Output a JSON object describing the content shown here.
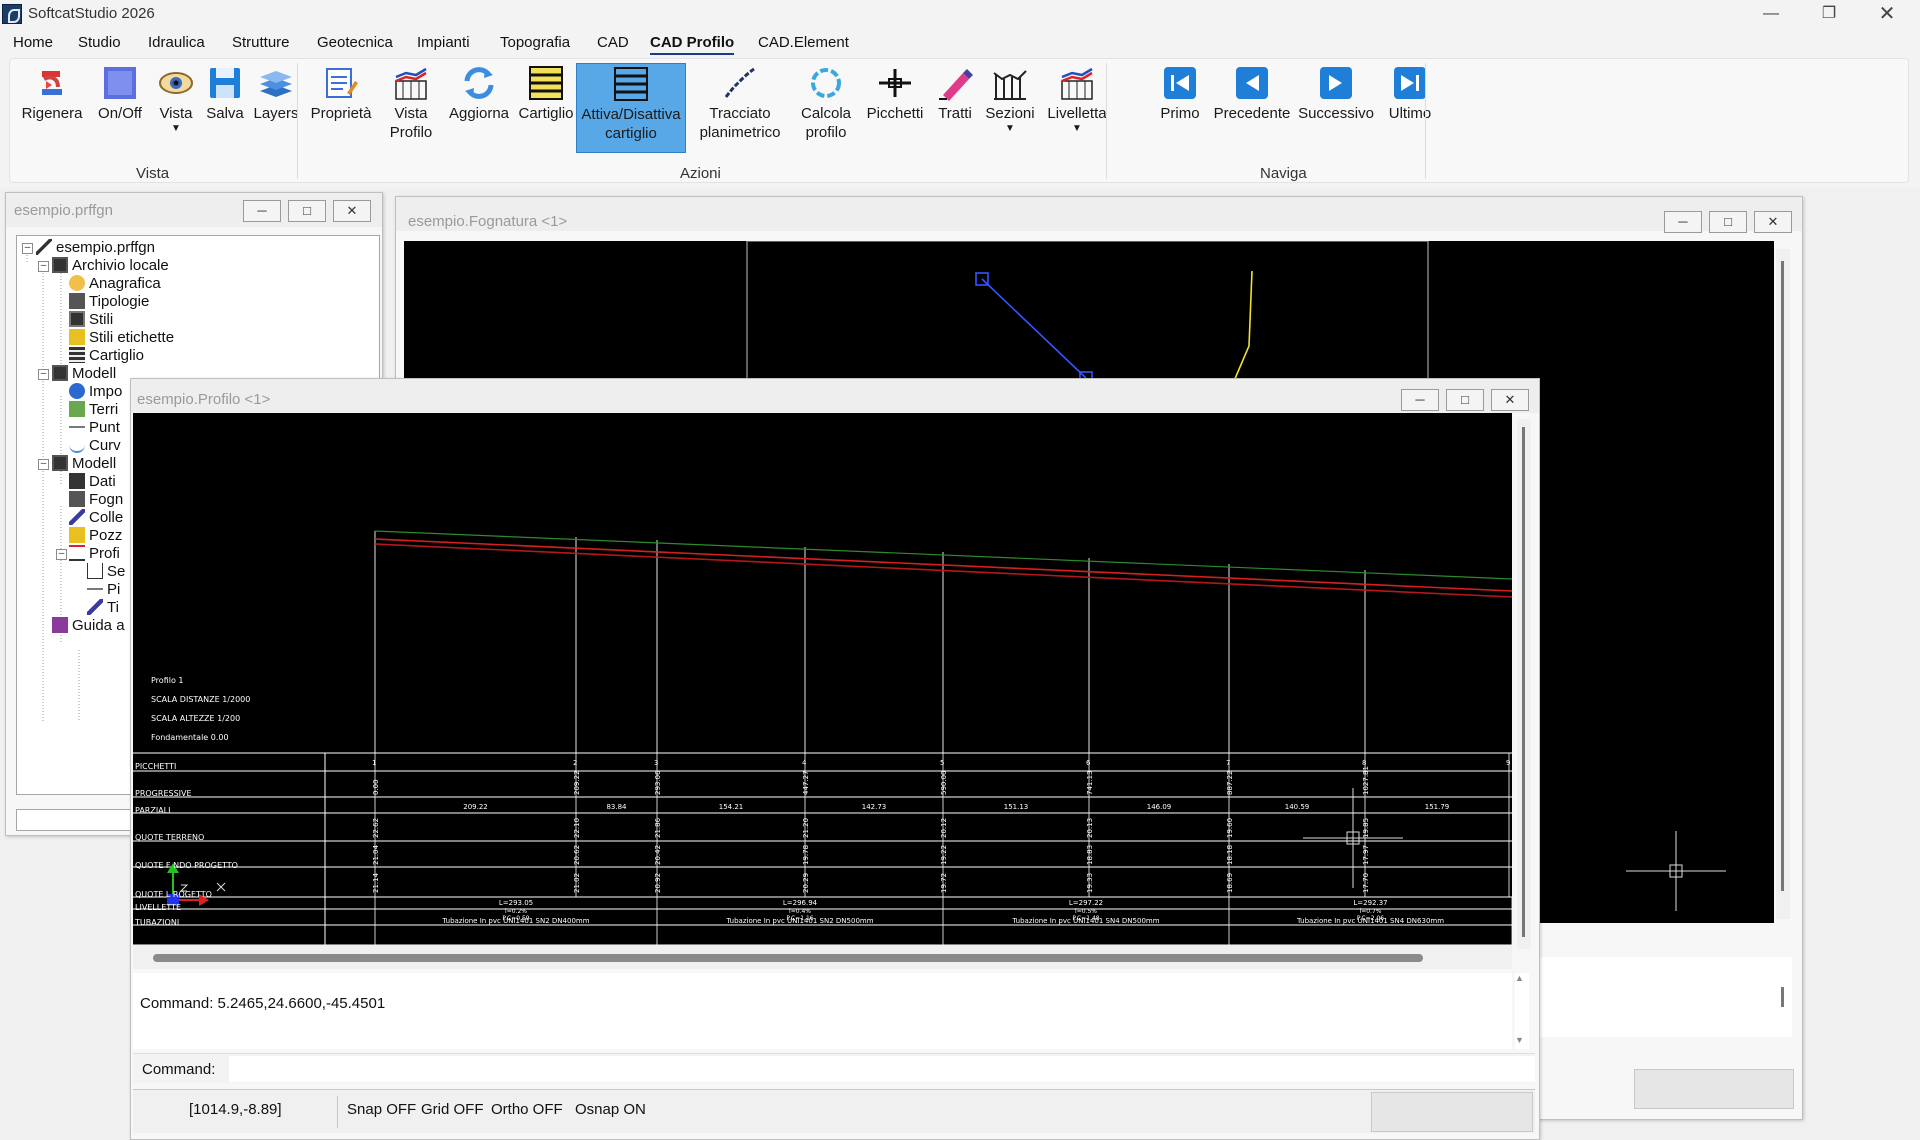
{
  "app": {
    "title": "SoftcatStudio 2026"
  },
  "menu": [
    {
      "label": "Home"
    },
    {
      "label": "Studio"
    },
    {
      "label": "Idraulica"
    },
    {
      "label": "Strutture"
    },
    {
      "label": "Geotecnica"
    },
    {
      "label": "Impianti"
    },
    {
      "label": "Topografia"
    },
    {
      "label": "CAD"
    },
    {
      "label": "CAD Profilo"
    },
    {
      "label": "CAD.Element"
    }
  ],
  "active_menu": "CAD Profilo",
  "ribbon": {
    "groups": {
      "vista": "Vista",
      "azioni": "Azioni",
      "naviga": "Naviga"
    },
    "vista": {
      "rigenera": "Rigenera",
      "onoff": "On/Off",
      "vista": "Vista",
      "salva": "Salva",
      "layers": "Layers"
    },
    "azioni": {
      "proprieta": "Proprietà",
      "vista_profilo_1": "Vista",
      "vista_profilo_2": "Profilo",
      "aggiorna": "Aggiorna",
      "cartiglio": "Cartiglio",
      "attiva_1": "Attiva/Disattiva",
      "attiva_2": "cartiglio",
      "tracciato_1": "Tracciato",
      "tracciato_2": "planimetrico",
      "calcola_1": "Calcola",
      "calcola_2": "profilo",
      "picchetti": "Picchetti",
      "tratti": "Tratti",
      "sezioni": "Sezioni",
      "livelletta": "Livelletta"
    },
    "naviga": {
      "primo": "Primo",
      "precedente": "Precedente",
      "successivo": "Successivo",
      "ultimo": "Ultimo"
    }
  },
  "project_window": {
    "title": "esempio.prffgn"
  },
  "tree": [
    {
      "label": "esempio.prffgn"
    },
    {
      "label": "Archivio locale"
    },
    {
      "label": "Anagrafica"
    },
    {
      "label": "Tipologie"
    },
    {
      "label": "Stili"
    },
    {
      "label": "Stili etichette"
    },
    {
      "label": "Cartiglio"
    },
    {
      "label": "Modell"
    },
    {
      "label": "Impo"
    },
    {
      "label": "Terri"
    },
    {
      "label": "Punt"
    },
    {
      "label": "Curv"
    },
    {
      "label": "Modell"
    },
    {
      "label": "Dati"
    },
    {
      "label": "Fogn"
    },
    {
      "label": "Colle"
    },
    {
      "label": "Pozz"
    },
    {
      "label": "Profi"
    },
    {
      "label": "Se"
    },
    {
      "label": "Pi"
    },
    {
      "label": "Ti"
    },
    {
      "label": "Guida a"
    }
  ],
  "fognatura_window": {
    "title": "esempio.Fognatura <1>"
  },
  "profilo_window": {
    "title": "esempio.Profilo <1>"
  },
  "profile": {
    "info": [
      "Profilo 1",
      "SCALA DISTANZE 1/2000",
      "SCALA ALTEZZE 1/200",
      "Fondamentale 0.00"
    ],
    "rows": [
      "PICCHETTI",
      "PROGRESSIVE",
      "PARZIALI",
      "QUOTE TERRENO",
      "QUOTE FONDO PROGETTO",
      "QUOTE SCORRIMENTO PROGETTO",
      "LIVELLETTE",
      "TUBAZIONI"
    ],
    "row_labels_visible": [
      "PICCHETTI",
      "PROGRESSIVE",
      "PARZIALI",
      "QUOTE TERRENO",
      "QUOTE F   NDO PROGETTO",
      "QUOTE     L  ROGETTO",
      "LIVELLETTE",
      "TUBAZIONI"
    ],
    "picchetti": [
      "1",
      "2",
      "3",
      "4",
      "5",
      "6",
      "7",
      "8",
      "9"
    ],
    "progressive": [
      "0.00",
      "209.22",
      "293.06",
      "447.27",
      "590.00",
      "741.13",
      "887.22",
      "1027.81"
    ],
    "parziali": [
      "209.22",
      "83.84",
      "154.21",
      "142.73",
      "151.13",
      "146.09",
      "140.59",
      "151.79"
    ],
    "quote_terreno": [
      "22.62",
      "22.10",
      "21.86",
      "21.20",
      "20.12",
      "20.13",
      "19.60",
      "19.85"
    ],
    "quote_fondo": [
      "21.04",
      "20.62",
      "20.42",
      "19.78",
      "19.22",
      "18.83",
      "18.18",
      "17.97"
    ],
    "quote_scorrimento": [
      "21.14",
      "21.02",
      "20.92",
      "20.29",
      "19.72",
      "19.33",
      "18.69",
      "17.70"
    ],
    "livellette": [
      {
        "l": "L=293.05",
        "p": "i=0.2%",
        "q": "P.C=0.59"
      },
      {
        "l": "L=296.94",
        "p": "i=0.4%",
        "q": "P.C=1.16"
      },
      {
        "l": "L=297.22",
        "p": "i=0.5%",
        "q": "P.C=1.48"
      },
      {
        "l": "L=292.37",
        "p": "i=0.7%",
        "q": "P.C=2.06"
      }
    ],
    "tubazioni": [
      "Tubazione In pvc UNI1401 SN2 DN400mm",
      "Tubazione In pvc UNI1401 SN2 DN500mm",
      "Tubazione In pvc UNI1401 SN4 DN500mm",
      "Tubazione In pvc UNI1401 SN4 DN630mm"
    ]
  },
  "command": {
    "history": "Command: 5.2465,24.6600,-45.4501",
    "prompt_label": "Command:",
    "value": ""
  },
  "status": {
    "coords": "[1014.9,-8.89]",
    "snap": "Snap OFF",
    "grid": "Grid OFF",
    "ortho": "Ortho OFF",
    "osnap": "Osnap ON"
  }
}
